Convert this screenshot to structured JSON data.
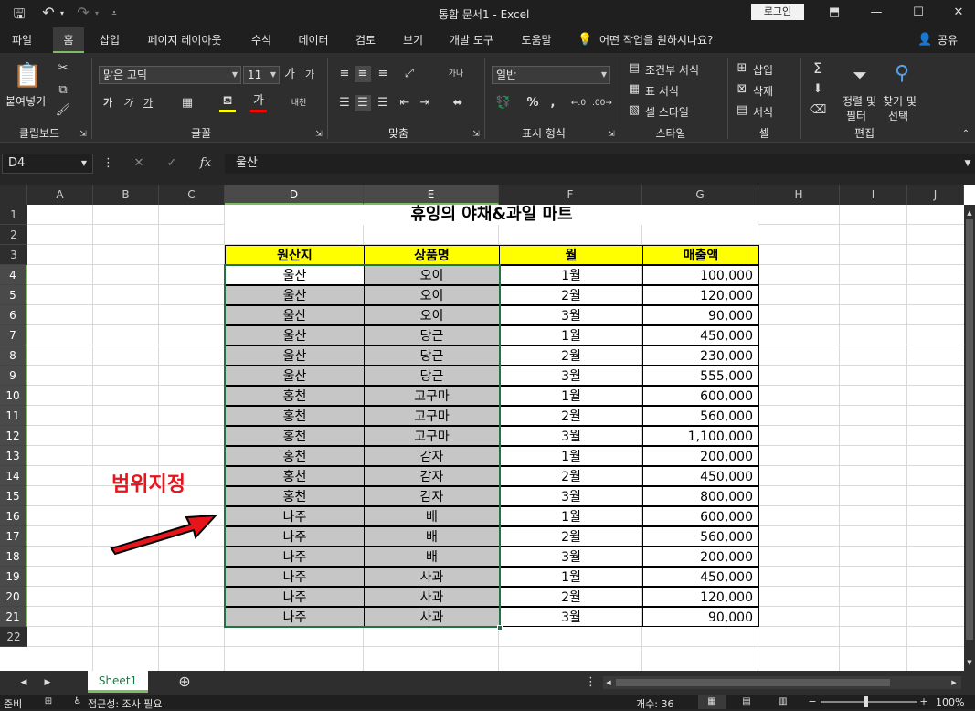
{
  "title_bar": {
    "doc_title": "통합 문서1 - Excel",
    "login_label": "로그인"
  },
  "tabs": [
    "파일",
    "홈",
    "삽입",
    "페이지 레이아웃",
    "수식",
    "데이터",
    "검토",
    "보기",
    "개발 도구",
    "도움말"
  ],
  "tell_me": "어떤 작업을 원하시나요?",
  "share_label": "공유",
  "ribbon": {
    "clipboard": {
      "paste": "붙여넣기",
      "label": "클립보드"
    },
    "font": {
      "name": "맑은 고딕",
      "size": "11",
      "label": "글꼴"
    },
    "align": {
      "label": "맞춤"
    },
    "number": {
      "format": "일반",
      "label": "표시 형식"
    },
    "styles": {
      "cond": "조건부 서식",
      "table": "표 서식",
      "cell": "셀 스타일",
      "label": "스타일"
    },
    "cells": {
      "insert": "삽입",
      "delete": "삭제",
      "format": "서식",
      "label": "셀"
    },
    "edit": {
      "sort1": "정렬 및",
      "sort2": "필터",
      "find1": "찾기 및",
      "find2": "선택",
      "label": "편집"
    }
  },
  "formula_bar": {
    "name_box": "D4",
    "fx": "fx",
    "value": "울산"
  },
  "columns": [
    "A",
    "B",
    "C",
    "D",
    "E",
    "F",
    "G",
    "H",
    "I",
    "J"
  ],
  "rows": [
    "1",
    "2",
    "3",
    "4",
    "5",
    "6",
    "7",
    "8",
    "9",
    "10",
    "11",
    "12",
    "13",
    "14",
    "15",
    "16",
    "17",
    "18",
    "19",
    "20",
    "21",
    "22"
  ],
  "sheet": {
    "title": "휴잉의 야채&과일 마트",
    "headers": [
      "원산지",
      "상품명",
      "월",
      "매출액"
    ],
    "data": [
      [
        "울산",
        "오이",
        "1월",
        "100,000"
      ],
      [
        "울산",
        "오이",
        "2월",
        "120,000"
      ],
      [
        "울산",
        "오이",
        "3월",
        "90,000"
      ],
      [
        "울산",
        "당근",
        "1월",
        "450,000"
      ],
      [
        "울산",
        "당근",
        "2월",
        "230,000"
      ],
      [
        "울산",
        "당근",
        "3월",
        "555,000"
      ],
      [
        "홍천",
        "고구마",
        "1월",
        "600,000"
      ],
      [
        "홍천",
        "고구마",
        "2월",
        "560,000"
      ],
      [
        "홍천",
        "고구마",
        "3월",
        "1,100,000"
      ],
      [
        "홍천",
        "감자",
        "1월",
        "200,000"
      ],
      [
        "홍천",
        "감자",
        "2월",
        "450,000"
      ],
      [
        "홍천",
        "감자",
        "3월",
        "800,000"
      ],
      [
        "나주",
        "배",
        "1월",
        "600,000"
      ],
      [
        "나주",
        "배",
        "2월",
        "560,000"
      ],
      [
        "나주",
        "배",
        "3월",
        "200,000"
      ],
      [
        "나주",
        "사과",
        "1월",
        "450,000"
      ],
      [
        "나주",
        "사과",
        "2월",
        "120,000"
      ],
      [
        "나주",
        "사과",
        "3월",
        "90,000"
      ]
    ],
    "annotation": "범위지정"
  },
  "sheet_tab": "Sheet1",
  "status": {
    "ready": "준비",
    "access": "접근성: 조사 필요",
    "count": "개수: 36",
    "zoom": "100%"
  },
  "colors": {
    "accent": "#7fba64",
    "header_fill": "#ffff00",
    "selection": "#c6c6c6",
    "annotation": "#e8141b"
  }
}
